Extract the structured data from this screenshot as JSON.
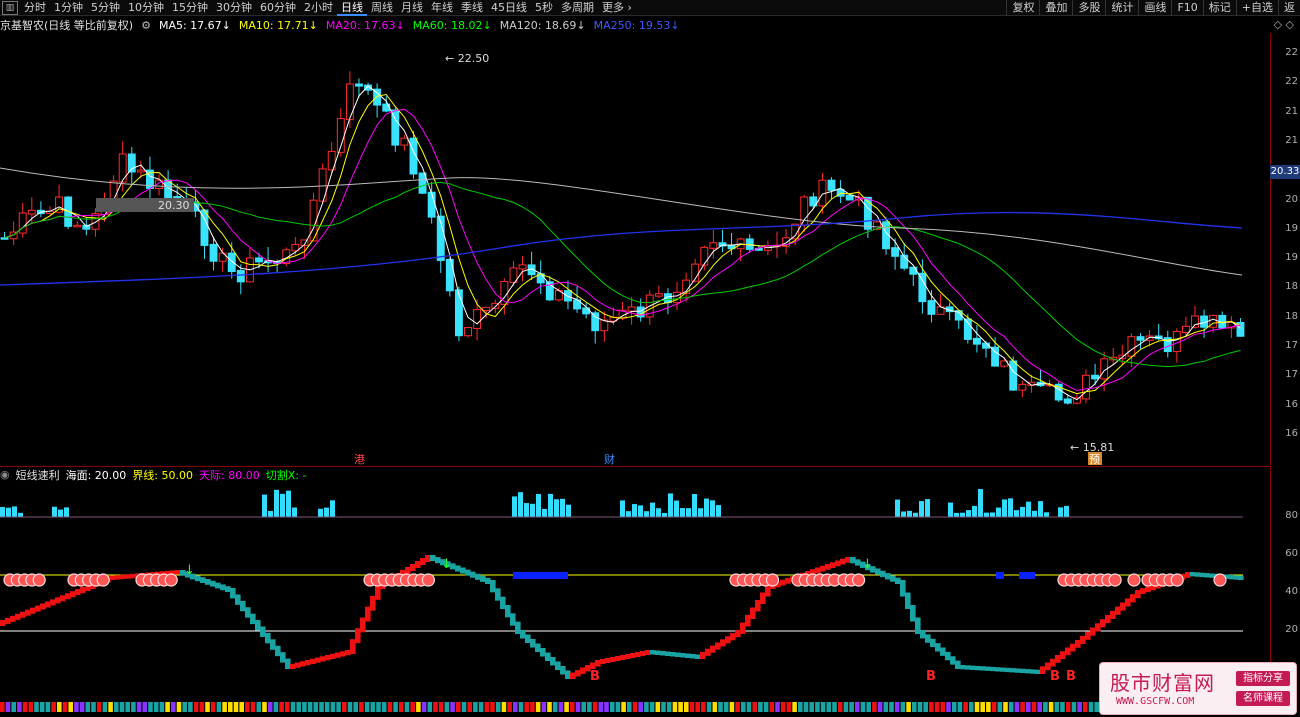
{
  "toolbar": {
    "left_icon": "▥",
    "tabs": [
      "分时",
      "1分钟",
      "5分钟",
      "10分钟",
      "15分钟",
      "30分钟",
      "60分钟",
      "2小时",
      "日线",
      "周线",
      "月线",
      "年线",
      "季线",
      "45日线",
      "5秒",
      "多周期",
      "更多"
    ],
    "active_tab": "日线",
    "right": [
      "复权",
      "叠加",
      "多股",
      "统计",
      "画线",
      "F10",
      "标记",
      "+自选",
      "返"
    ]
  },
  "info": {
    "title": "京基智农(日线 等比前复权)",
    "ma": [
      {
        "label": "MA5: 17.67",
        "color": "#ffffff"
      },
      {
        "label": "MA10: 17.71",
        "color": "#ffff00"
      },
      {
        "label": "MA20: 17.63",
        "color": "#ff00ff"
      },
      {
        "label": "MA60: 18.02",
        "color": "#00ff00"
      },
      {
        "label": "MA120: 18.69",
        "color": "#cccccc"
      },
      {
        "label": "MA250: 19.53",
        "color": "#3b5bff"
      }
    ],
    "arrow": "↓",
    "right_icons": "◇ ◇"
  },
  "price_axis": {
    "ticks": [
      "22",
      "22",
      "21",
      "21",
      "20",
      "20",
      "19",
      "19",
      "18",
      "18",
      "17",
      "17",
      "16",
      "16"
    ],
    "current_price": "20.33"
  },
  "annotations": {
    "high_label": "22.50",
    "low_label": "15.81",
    "hover_label": "20.30",
    "event_gang": "港",
    "event_cai": "财",
    "event_yu": "预"
  },
  "indicator": {
    "name": "短线速利",
    "haimian": "海面: 20.00",
    "jiexian": "界线: 50.00",
    "tianji": "天际: 80.00",
    "qiege": "切割X: -",
    "axis_ticks": [
      "80",
      "60",
      "40",
      "20"
    ],
    "b_label": "B"
  },
  "colors": {
    "up": "#ff2b2b",
    "down": "#39e3ff",
    "teal": "#1aa3a3",
    "accent": "#1f3a7a"
  },
  "watermark": {
    "title": "股市财富网",
    "url": "WWW.GSCFW.COM",
    "badge1": "指标分享",
    "badge2": "名师课程"
  }
}
